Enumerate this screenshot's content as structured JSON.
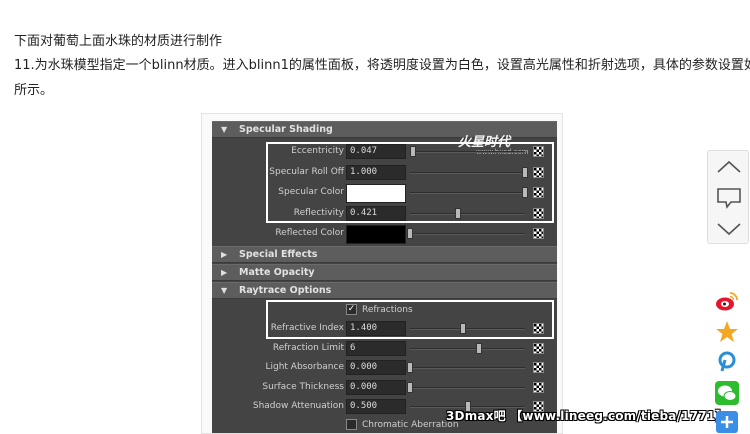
{
  "article": {
    "line1": "下面对葡萄上面水珠的材质进行制作",
    "line2": "11.为水珠模型指定一个blinn材质。进入blinn1的属性面板，将透明度设置为白色，设置高光属性和折射选项，具体的参数设置如下图",
    "line3": "所示。"
  },
  "maya": {
    "logo": "火星时代",
    "logo_url": "www.hxsd.com",
    "sections": {
      "specular": "Specular Shading",
      "special": "Special Effects",
      "matte": "Matte Opacity",
      "raytrace": "Raytrace Options"
    },
    "specular_rows": [
      {
        "label": "Eccentricity",
        "value": "0.047",
        "slider": 0.03
      },
      {
        "label": "Specular Roll Off",
        "value": "1.000",
        "slider": 1.0
      },
      {
        "label": "Specular Color",
        "color": "#ffffff",
        "slider": 1.0
      },
      {
        "label": "Reflectivity",
        "value": "0.421",
        "slider": 0.42
      },
      {
        "label": "Reflected Color",
        "color": "#000000",
        "slider": 0.0
      }
    ],
    "refractions_label": "Refractions",
    "refractions_checked": true,
    "raytrace_rows": [
      {
        "label": "Refractive Index",
        "value": "1.400",
        "slider": 0.46
      },
      {
        "label": "Refraction Limit",
        "value": "6",
        "slider": 0.6
      },
      {
        "label": "Light Absorbance",
        "value": "0.000",
        "slider": 0.0
      },
      {
        "label": "Surface Thickness",
        "value": "0.000",
        "slider": 0.0
      },
      {
        "label": "Shadow Attenuation",
        "value": "0.500",
        "slider": 0.5
      }
    ],
    "chromatic_label": "Chromatic Aberration",
    "chromatic_checked": false
  },
  "watermark": "3Dmax吧 【www.lineeg.com/tieba/1771】",
  "float_nav": {
    "icons": [
      "chevron-up-icon",
      "comment-icon",
      "chevron-down-icon"
    ]
  },
  "share": {
    "icons": [
      "weibo-icon",
      "qzone-star-icon",
      "pinterest-icon",
      "wechat-icon",
      "more-icon"
    ],
    "colors": {
      "weibo": "#e6162d",
      "qzone": "#f5a623",
      "pinterest": "#2a8ed8",
      "wechat": "#2dbc2d",
      "more": "#3a8ee6"
    }
  }
}
